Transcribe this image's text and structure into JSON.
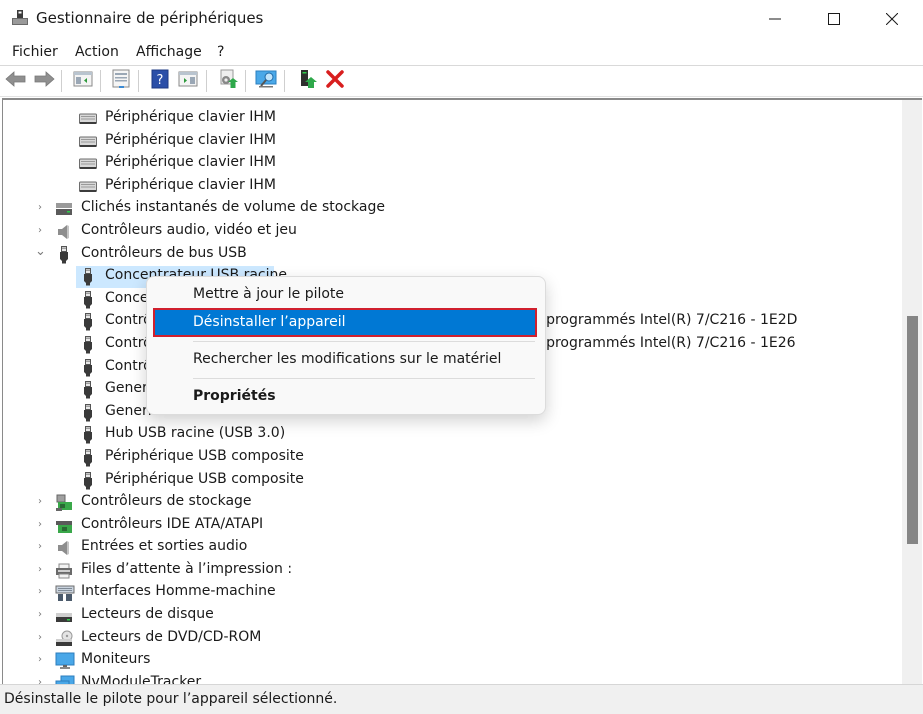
{
  "window": {
    "title": "Gestionnaire de périphériques",
    "controls": {
      "minimize": "minimize-icon",
      "maximize": "maximize-icon",
      "close": "close-icon"
    }
  },
  "menubar": [
    "Fichier",
    "Action",
    "Affichage",
    "?"
  ],
  "toolbar": [
    {
      "name": "back-button",
      "icon": "arrow-left-icon"
    },
    {
      "name": "forward-button",
      "icon": "arrow-right-icon"
    },
    {
      "name": "show-hide-console-tree-button",
      "icon": "console-tree-icon"
    },
    {
      "name": "properties-button",
      "icon": "properties-sheet-icon"
    },
    {
      "name": "help-button",
      "icon": "help-icon"
    },
    {
      "name": "show-hide-action-pane-button",
      "icon": "action-pane-icon"
    },
    {
      "name": "update-driver-button",
      "icon": "update-driver-icon"
    },
    {
      "name": "scan-hardware-button",
      "icon": "scan-monitor-icon"
    },
    {
      "name": "enable-device-button",
      "icon": "enable-device-icon"
    },
    {
      "name": "uninstall-device-button",
      "icon": "red-x-icon"
    }
  ],
  "tree": [
    {
      "type": "child",
      "label": "Périphérique clavier IHM",
      "icon": "keyboard-icon"
    },
    {
      "type": "child",
      "label": "Périphérique clavier IHM",
      "icon": "keyboard-icon"
    },
    {
      "type": "child",
      "label": "Périphérique clavier IHM",
      "icon": "keyboard-icon"
    },
    {
      "type": "child",
      "label": "Périphérique clavier IHM",
      "icon": "keyboard-icon"
    },
    {
      "type": "cat",
      "expanded": false,
      "label": "Clichés instantanés de volume de stockage",
      "icon": "storage-volume-icon"
    },
    {
      "type": "cat",
      "expanded": false,
      "label": "Contrôleurs audio, vidéo et jeu",
      "icon": "speaker-icon"
    },
    {
      "type": "cat",
      "expanded": true,
      "label": "Contrôleurs de bus USB",
      "icon": "usb-plug-icon"
    },
    {
      "type": "child",
      "selected": true,
      "label": "Concentrateur USB racine",
      "icon": "usb-plug-icon"
    },
    {
      "type": "child",
      "label": "Concentrateur USB racine",
      "icon": "usb-plug-icon"
    },
    {
      "type": "child",
      "label": "Contrôleur d’hôte USB amélioré de la famille de jeux de puces programmés Intel(R) 7/C216 - 1E2D",
      "visible_suffix": "mmés Intel(R) 7/C216 - 1E2D",
      "icon": "usb-plug-icon"
    },
    {
      "type": "child",
      "label": "Contrôleur d’hôte USB amélioré de la famille de jeux de puces programmés Intel(R) 7/C216 - 1E26",
      "visible_suffix": "mmés Intel(R) 7/C216 - 1E26",
      "icon": "usb-plug-icon"
    },
    {
      "type": "child",
      "label": "Contrôleur USB",
      "icon": "usb-plug-icon"
    },
    {
      "type": "child",
      "label": "Generic USB Hub",
      "icon": "usb-plug-icon"
    },
    {
      "type": "child",
      "label": "Generic USB Hub",
      "icon": "usb-plug-icon"
    },
    {
      "type": "child",
      "label": "Hub USB racine (USB 3.0)",
      "icon": "usb-plug-icon"
    },
    {
      "type": "child",
      "label": "Périphérique USB composite",
      "icon": "usb-plug-icon"
    },
    {
      "type": "child",
      "label": "Périphérique USB composite",
      "icon": "usb-plug-icon"
    },
    {
      "type": "cat",
      "expanded": false,
      "label": "Contrôleurs de stockage",
      "icon": "storage-controller-icon"
    },
    {
      "type": "cat",
      "expanded": false,
      "label": "Contrôleurs IDE ATA/ATAPI",
      "icon": "ide-controller-icon"
    },
    {
      "type": "cat",
      "expanded": false,
      "label": "Entrées et sorties audio",
      "icon": "speaker-icon"
    },
    {
      "type": "cat",
      "expanded": false,
      "label": "Files d’attente à l’impression :",
      "icon": "printer-icon"
    },
    {
      "type": "cat",
      "expanded": false,
      "label": "Interfaces Homme-machine",
      "icon": "hid-icon"
    },
    {
      "type": "cat",
      "expanded": false,
      "label": "Lecteurs de disque",
      "icon": "disk-drive-icon"
    },
    {
      "type": "cat",
      "expanded": false,
      "label": "Lecteurs de DVD/CD-ROM",
      "icon": "dvd-drive-icon"
    },
    {
      "type": "cat",
      "expanded": false,
      "label": "Moniteurs",
      "icon": "monitor-icon"
    },
    {
      "type": "cat",
      "expanded": false,
      "label": "NvModuleTracker",
      "icon": "network-modules-icon"
    }
  ],
  "scrollbar": {
    "thumb_start_fraction": 0.37,
    "thumb_size_fraction": 0.39
  },
  "context_menu": {
    "items": [
      {
        "label": "Mettre à jour le pilote",
        "highlighted": false,
        "bold": false
      },
      {
        "label": "Désinstaller l’appareil",
        "highlighted": true,
        "bold": false
      },
      {
        "separator": true
      },
      {
        "label": "Rechercher les modifications sur le matériel",
        "highlighted": false,
        "bold": false
      },
      {
        "separator": true
      },
      {
        "label": "Propriétés",
        "highlighted": false,
        "bold": true
      }
    ]
  },
  "status_bar": {
    "text": "Désinstalle le pilote pour l’appareil sélectionné."
  },
  "colors": {
    "selection": "#cce8ff",
    "menu_highlight": "#0078d4",
    "annotation_border": "#d0202e",
    "scroll_thumb": "#858585"
  }
}
